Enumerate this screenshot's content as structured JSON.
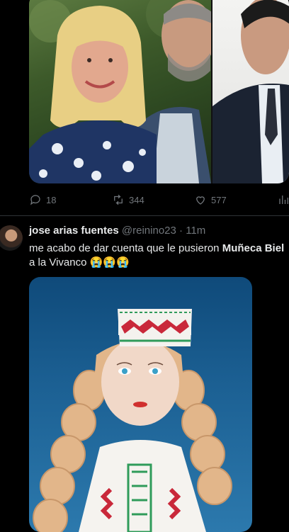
{
  "prev_tweet": {
    "actions": {
      "reply_count": "18",
      "retweet_count": "344",
      "like_count": "577"
    }
  },
  "tweet": {
    "display_name": "jose arias fuentes",
    "handle": "@reinino23",
    "separator": "·",
    "time": "11m",
    "text_line1_prefix": "me acabo de dar cuenta que le pusieron ",
    "text_line1_bold": "Muñeca Biel",
    "text_line2": "a la Vivanco ",
    "emoji": "😭😭😭"
  },
  "colors": {
    "background": "#000000",
    "text_primary": "#e7e9ea",
    "text_secondary": "#71767b",
    "divider": "#2f3336"
  },
  "icons": [
    "reply-icon",
    "retweet-icon",
    "like-icon",
    "views-icon"
  ]
}
